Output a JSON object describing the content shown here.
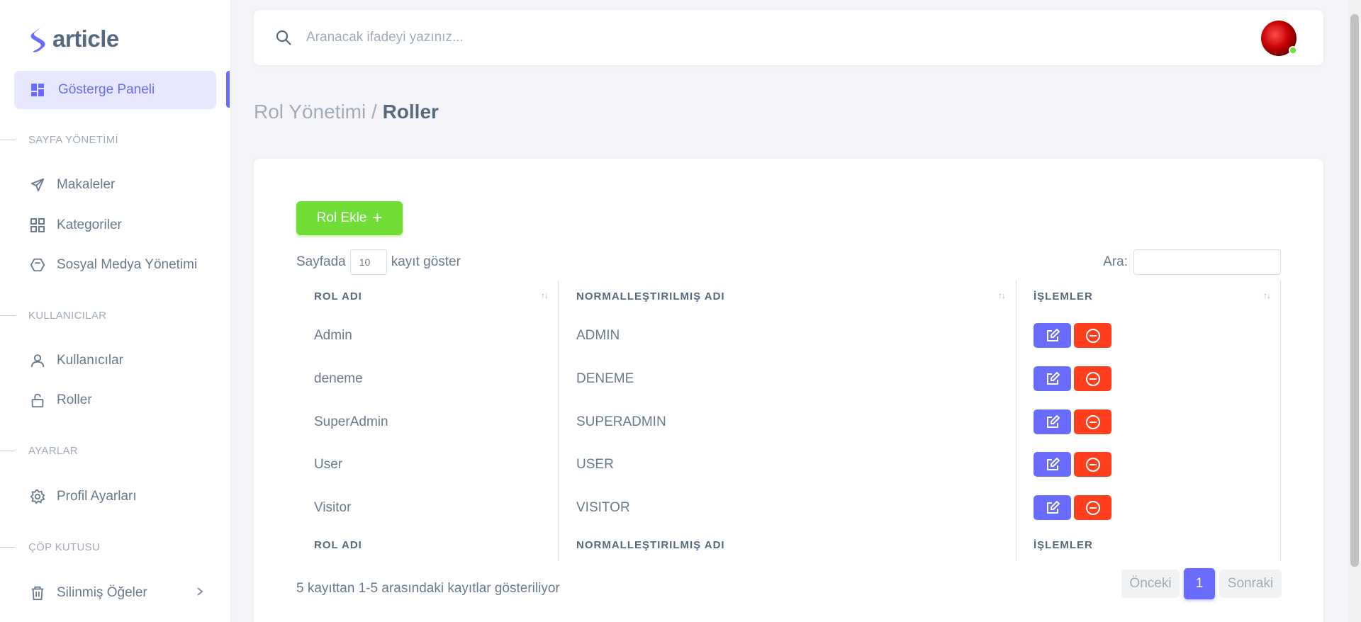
{
  "brand": {
    "name": "article"
  },
  "sidebar": {
    "active": {
      "label": "Gösterge Paneli",
      "icon": "dashboard-icon"
    },
    "sections": [
      {
        "header": "SAYFA YÖNETİMİ",
        "items": [
          {
            "label": "Makaleler",
            "icon": "send-icon"
          },
          {
            "label": "Kategoriler",
            "icon": "grid-icon"
          },
          {
            "label": "Sosyal Medya Yönetimi",
            "icon": "hexagon-icon"
          }
        ]
      },
      {
        "header": "KULLANICILAR",
        "items": [
          {
            "label": "Kullanıcılar",
            "icon": "user-icon"
          },
          {
            "label": "Roller",
            "icon": "lock-icon"
          }
        ]
      },
      {
        "header": "AYARLAR",
        "items": [
          {
            "label": "Profil Ayarları",
            "icon": "gear-icon"
          }
        ]
      },
      {
        "header": "ÇÖP KUTUSU",
        "items": [
          {
            "label": "Silinmiş Öğeler",
            "icon": "trash-icon"
          }
        ]
      }
    ]
  },
  "navbar": {
    "search_placeholder": "Aranacak ifadeyi yazınız..."
  },
  "breadcrumb": {
    "parent": "Rol Yönetimi /",
    "current": "Roller"
  },
  "toolbar": {
    "add_label": "Rol Ekle",
    "length_prefix": "Sayfada",
    "length_value": "10",
    "length_suffix": "kayıt göster",
    "search_label": "Ara:"
  },
  "table": {
    "columns": [
      "ROL ADI",
      "NORMALLEŞTIRILMIŞ ADI",
      "İŞLEMLER"
    ],
    "sort_glyph": "↑↓",
    "rows": [
      {
        "name": "Admin",
        "normalized": "ADMIN"
      },
      {
        "name": "deneme",
        "normalized": "DENEME"
      },
      {
        "name": "SuperAdmin",
        "normalized": "SUPERADMIN"
      },
      {
        "name": "User",
        "normalized": "USER"
      },
      {
        "name": "Visitor",
        "normalized": "VISITOR"
      }
    ]
  },
  "footer": {
    "info": "5 kayıttan 1-5 arasındaki kayıtlar gösteriliyor",
    "prev": "Önceki",
    "page": "1",
    "next": "Sonraki"
  },
  "colors": {
    "primary": "#696cff",
    "success": "#71dd37",
    "danger": "#ff3e1d"
  }
}
